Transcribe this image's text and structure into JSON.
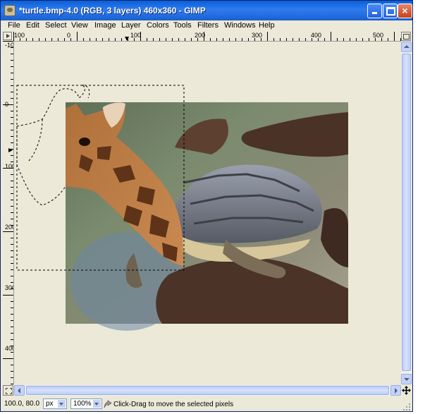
{
  "window": {
    "title": "*turtle.bmp-4.0 (RGB, 3 layers) 460x360 - GIMP",
    "buttons": {
      "minimize": "minimize",
      "maximize": "maximize",
      "close": "×"
    }
  },
  "menu": [
    {
      "name": "file",
      "label": "File"
    },
    {
      "name": "edit",
      "label": "Edit"
    },
    {
      "name": "select",
      "label": "Select"
    },
    {
      "name": "view",
      "label": "View"
    },
    {
      "name": "image",
      "label": "Image"
    },
    {
      "name": "layer",
      "label": "Layer"
    },
    {
      "name": "colors",
      "label": "Colors"
    },
    {
      "name": "tools",
      "label": "Tools"
    },
    {
      "name": "filters",
      "label": "Filters"
    },
    {
      "name": "windows",
      "label": "Windows"
    },
    {
      "name": "help",
      "label": "Help"
    }
  ],
  "rulers": {
    "horizontal": [
      "-100",
      "0",
      "100",
      "200",
      "300",
      "400",
      "500"
    ],
    "vertical": [
      "-100",
      "0",
      "100",
      "200",
      "300",
      "400"
    ]
  },
  "canvas": {
    "background": "#ece9d8",
    "layers": [
      "giraffe",
      "turtle",
      "background"
    ]
  },
  "status": {
    "coords": "100.0, 80.0",
    "unit": "px",
    "zoom": "100%",
    "message": "Click-Drag to move the selected pixels"
  },
  "icons": {
    "navigate": "navigate-icon",
    "move": "move-icon",
    "quick_mask": "quick-mask-icon",
    "tool": "move-tool-icon"
  }
}
